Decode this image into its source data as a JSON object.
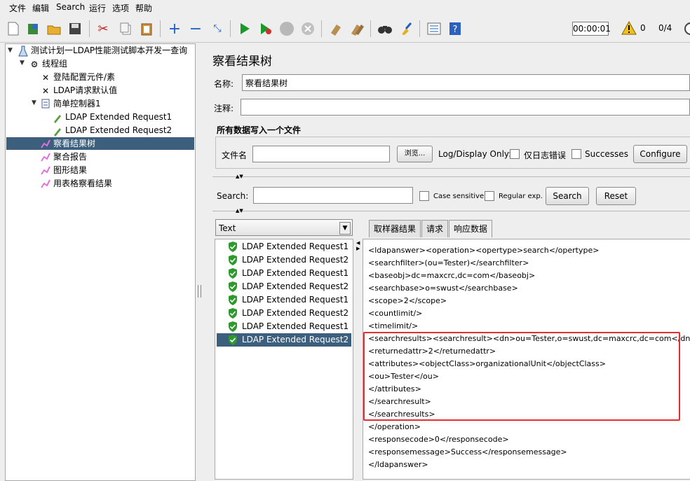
{
  "menu": [
    "文件",
    "编辑",
    "Search",
    "运行",
    "选项",
    "帮助"
  ],
  "status": {
    "timer": "00:00:01",
    "warning_count": "0",
    "threads": "0/4"
  },
  "tree": {
    "root": "测试计划一LDAP性能测试脚本开发一查询",
    "thread_group": "线程组",
    "login_config": "登陆配置元件/素",
    "ldap_defaults": "LDAP请求默认值",
    "simple_controller": "简单控制器1",
    "request1": "LDAP Extended Request1",
    "request2": "LDAP Extended Request2",
    "view_results_tree": "察看结果树",
    "aggregate_report": "聚合报告",
    "graph_results": "图形结果",
    "table_results": "用表格察看结果"
  },
  "panel": {
    "title": "察看结果树",
    "name_label": "名称:",
    "name_value": "察看结果树",
    "comment_label": "注释:",
    "comment_value": "",
    "file_section_title": "所有数据写入一个文件",
    "filename_label": "文件名",
    "filename_value": "",
    "browse_label": "浏览...",
    "log_display_only": "Log/Display Only:",
    "errors_only_label": "仅日志错误",
    "successes_label": "Successes",
    "configure_label": "Configure"
  },
  "search": {
    "label": "Search:",
    "value": "",
    "case_sensitive_label": "Case sensitive",
    "regex_label": "Regular exp.",
    "search_button": "Search",
    "reset_button": "Reset"
  },
  "renderer": {
    "selected": "Text"
  },
  "results": [
    "LDAP Extended Request1",
    "LDAP Extended Request2",
    "LDAP Extended Request1",
    "LDAP Extended Request2",
    "LDAP Extended Request1",
    "LDAP Extended Request2",
    "LDAP Extended Request1",
    "LDAP Extended Request2"
  ],
  "tabs": [
    "取样器结果",
    "请求",
    "响应数据"
  ],
  "response_lines": [
    "<ldapanswer><operation><opertype>search</opertype>",
    "<searchfilter>(ou=Tester)</searchfilter>",
    "<baseobj>dc=maxcrc,dc=com</baseobj>",
    "<searchbase>o=swust</searchbase>",
    "<scope>2</scope>",
    "<countlimit/>",
    "<timelimit/>",
    "<searchresults><searchresult><dn>ou=Tester,o=swust,dc=maxcrc,dc=com</dn>",
    "<returnedattr>2</returnedattr>",
    "<attributes><objectClass>organizationalUnit</objectClass>",
    "<ou>Tester</ou>",
    "</attributes>",
    "</searchresult>",
    "</searchresults>",
    "</operation>",
    "<responsecode>0</responsecode>",
    "<responsemessage>Success</responsemessage>",
    "</ldapanswer>"
  ],
  "colors": {
    "selection": "#3c5f7d",
    "highlight_box": "#e03030",
    "success_green": "#2e9a2e"
  }
}
